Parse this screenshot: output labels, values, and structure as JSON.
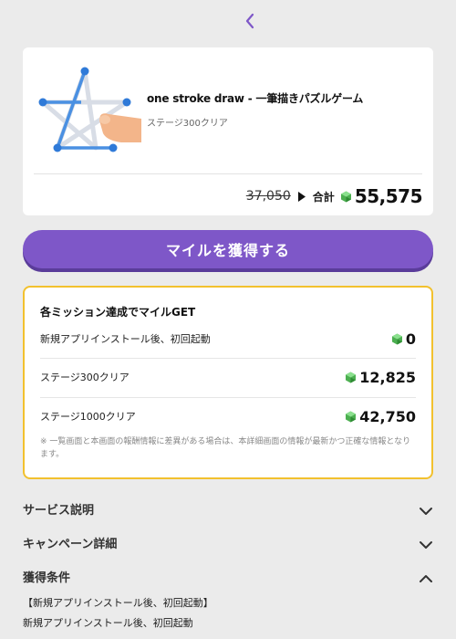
{
  "nav": {
    "back_icon": "chevron-left-icon"
  },
  "app": {
    "title": "one stroke draw - 一筆描きパズルゲーム",
    "subtitle": "ステージ300クリア",
    "old_price": "37,050",
    "total_label": "合計",
    "total_value": "55,575"
  },
  "cta": {
    "label": "マイルを獲得する"
  },
  "missions": {
    "heading": "各ミッション達成でマイルGET",
    "rows": [
      {
        "label": "新規アプリインストール後、初回起動",
        "value": "0"
      },
      {
        "label": "ステージ300クリア",
        "value": "12,825"
      },
      {
        "label": "ステージ1000クリア",
        "value": "42,750"
      }
    ],
    "note": "※ 一覧画面と本画面の報酬情報に差異がある場合は、本詳細画面の情報が最新かつ正確な情報となります。"
  },
  "sections": [
    {
      "label": "サービス説明",
      "state": "collapsed"
    },
    {
      "label": "キャンペーン詳細",
      "state": "collapsed"
    },
    {
      "label": "獲得条件",
      "state": "expanded"
    }
  ],
  "conditions": {
    "line1": "【新規アプリインストール後、初回起動】",
    "line2": "新規アプリインストール後、初回起動"
  },
  "colors": {
    "accent": "#7e57c8",
    "mission_border": "#f2c12e",
    "gem": "#4caf50",
    "background": "#ebebeb"
  }
}
